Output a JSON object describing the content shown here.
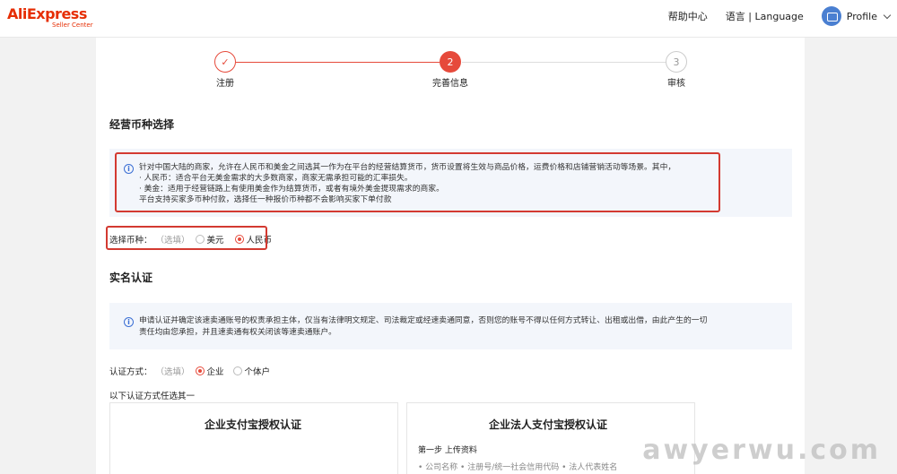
{
  "header": {
    "logo_main": "AliExpress",
    "logo_sub": "Seller Center",
    "help": "帮助中心",
    "language": "语言 | Language",
    "profile": "Profile"
  },
  "steps": [
    {
      "label": "注册",
      "number": "✓",
      "state": "done"
    },
    {
      "label": "完善信息",
      "number": "2",
      "state": "active"
    },
    {
      "label": "审核",
      "number": "3",
      "state": "todo"
    }
  ],
  "currency": {
    "title": "经营币种选择",
    "notice_lines": [
      "针对中国大陆的商家，允许在人民币和美金之间选其一作为在平台的经营结算货币，货币设置将生效与商品价格，运费价格和店铺营销活动等场景。其中，",
      "· 人民币：适合平台无美金需求的大多数商家，商家无需承担可能的汇率损失。",
      "· 美金：适用于经营链路上有使用美金作为结算货币，或者有境外美金提现需求的商家。",
      "平台支持买家多币种付款，选择任一种报价币种都不会影响买家下单付款"
    ],
    "select_label": "选择币种：",
    "optional": "（选填）",
    "options": [
      "美元",
      "人民币"
    ],
    "selected": "人民币"
  },
  "verification": {
    "title": "实名认证",
    "notice_lines": [
      "申请认证并确定该速卖通账号的权责承担主体，仅当有法律明文规定、司法裁定或经速卖通同意，否则您的账号不得以任何方式转让、出租或出借，由此产生的一切",
      "责任均由您承担，并且速卖通有权关闭该等速卖通账户。"
    ],
    "method_label": "认证方式：",
    "optional": "（选填）",
    "options": [
      "企业",
      "个体户"
    ],
    "selected": "企业",
    "choose_hint": "以下认证方式任选其一",
    "cards": [
      {
        "title": "企业支付宝授权认证",
        "step": "",
        "bullet": ""
      },
      {
        "title": "企业法人支付宝授权认证",
        "step": "第一步 上传资料",
        "bullet": "• 公司名称 • 注册号/统一社会信用代码 • 法人代表姓名"
      }
    ]
  },
  "watermark": "awyerwu.com",
  "colors": {
    "accent": "#e64a3b",
    "info": "#3b6fd4",
    "frame": "#d33a31"
  }
}
